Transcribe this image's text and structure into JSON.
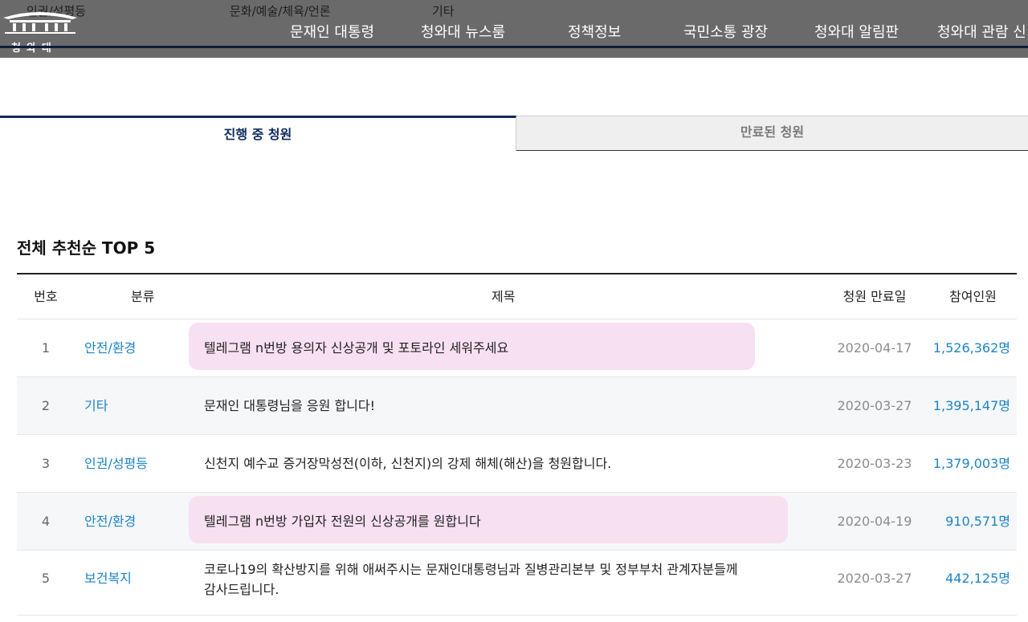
{
  "header": {
    "logo_text": "청와대",
    "ghost_categories": [
      "인권/성평등",
      "문화/예술/체육/언론",
      "기타"
    ],
    "nav": [
      "문재인 대통령",
      "청와대 뉴스룸",
      "정책정보",
      "국민소통 광장",
      "청와대 알림판",
      "청와대 관람 신"
    ]
  },
  "tabs": {
    "active": "진행 중 청원",
    "inactive": "만료된 청원"
  },
  "section_title": "전체 추천순 TOP 5",
  "table": {
    "headers": {
      "num": "번호",
      "category": "분류",
      "title": "제목",
      "date": "청원 만료일",
      "count": "참여인원"
    },
    "rows": [
      {
        "num": "1",
        "category": "안전/환경",
        "title": "텔레그램 n번방 용의자 신상공개 및 포토라인 세워주세요",
        "date": "2020-04-17",
        "count": "1,526,362명"
      },
      {
        "num": "2",
        "category": "기타",
        "title": "문재인 대통령님을 응원 합니다!",
        "date": "2020-03-27",
        "count": "1,395,147명"
      },
      {
        "num": "3",
        "category": "인권/성평등",
        "title": "신천지 예수교 증거장막성전(이하, 신천지)의 강제 해체(해산)을 청원합니다.",
        "date": "2020-03-23",
        "count": "1,379,003명"
      },
      {
        "num": "4",
        "category": "안전/환경",
        "title": "텔레그램 n번방 가입자 전원의 신상공개를 원합니다",
        "date": "2020-04-19",
        "count": "910,571명"
      },
      {
        "num": "5",
        "category": "보건복지",
        "title_line1": "코로나19의 확산방지를 위해 애써주시는 문재인대통령님과 질병관리본부 및 정부부처 관계자분들께",
        "title_line2": "감사드립니다.",
        "date": "2020-03-27",
        "count": "442,125명"
      }
    ]
  },
  "colors": {
    "accent": "#1c84c6",
    "highlight": "#f7e0f1",
    "navy": "#0e2a5e",
    "header_bg": "#6a6a6a"
  }
}
